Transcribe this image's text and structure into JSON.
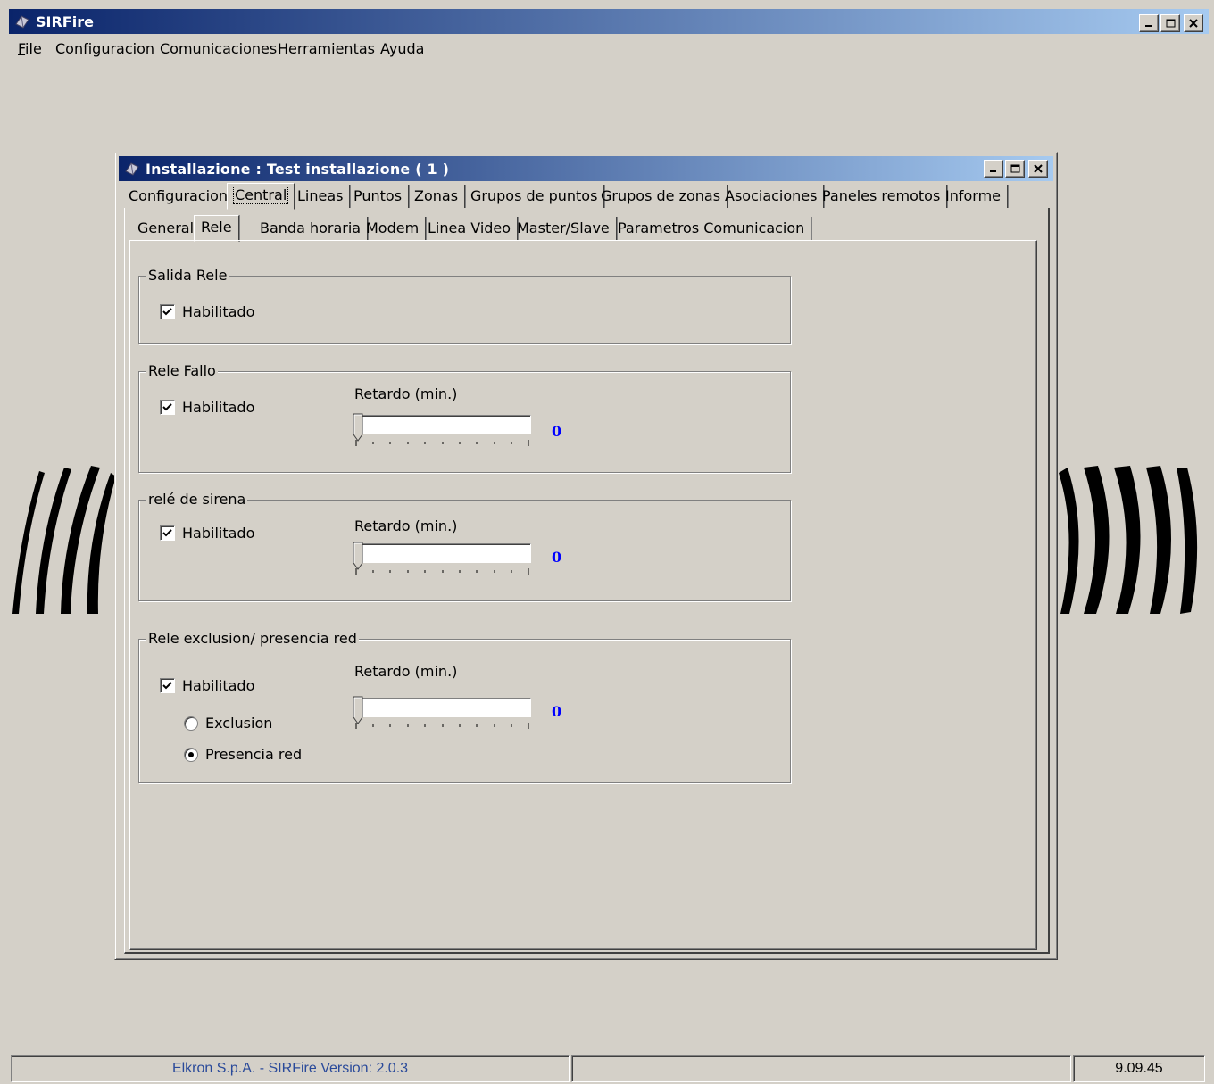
{
  "app": {
    "title": "SIRFire",
    "caption_buttons": [
      "minimize",
      "maximize",
      "close"
    ]
  },
  "menubar": [
    {
      "label": "File",
      "mnemonic": "F"
    },
    {
      "label": "Configuracion"
    },
    {
      "label": "Comunicaciones"
    },
    {
      "label": "Herramientas",
      "mnemonic": "e"
    },
    {
      "label": "Ayuda",
      "mnemonic": "A"
    }
  ],
  "child_window": {
    "title": "Installazione : Test installazione  ( 1 )"
  },
  "main_tabs": [
    "Configuracion",
    "Central",
    "Lineas",
    "Puntos",
    "Zonas",
    "Grupos de puntos",
    "Grupos de zonas",
    "Asociaciones",
    "Paneles remotos",
    "Informe"
  ],
  "main_tab_selected": "Central",
  "sub_tabs": [
    "General",
    "Rele",
    "Banda horaria",
    "Modem",
    "Linea Video",
    "Master/Slave",
    "Parametros Comunicacion"
  ],
  "sub_tab_selected": "Rele",
  "groups": {
    "salida_rele": {
      "title": "Salida Rele",
      "habilitado_label": "Habilitado",
      "habilitado_checked": true
    },
    "rele_fallo": {
      "title": "Rele Fallo",
      "habilitado_label": "Habilitado",
      "habilitado_checked": true,
      "delay_label": "Retardo (min.)",
      "delay_value": "0"
    },
    "rele_sirena": {
      "title": "relé de sirena",
      "habilitado_label": "Habilitado",
      "habilitado_checked": true,
      "delay_label": "Retardo (min.)",
      "delay_value": "0"
    },
    "rele_exclusion": {
      "title": "Rele exclusion/ presencia red",
      "habilitado_label": "Habilitado",
      "habilitado_checked": true,
      "delay_label": "Retardo (min.)",
      "delay_value": "0",
      "radio_exclusion": "Exclusion",
      "radio_presencia": "Presencia red",
      "selected_radio": "Presencia red"
    }
  },
  "statusbar": {
    "version_text": "Elkron S.p.A.  -  SIRFire  Version: 2.0.3",
    "middle_text": "",
    "right_text": "9.09.45"
  },
  "colors": {
    "titlebar_start": "#0a246a",
    "titlebar_end": "#a6caf0",
    "face": "#d4d0c8",
    "value_blue": "#0000ff",
    "status_blue": "#2a4a9a"
  }
}
